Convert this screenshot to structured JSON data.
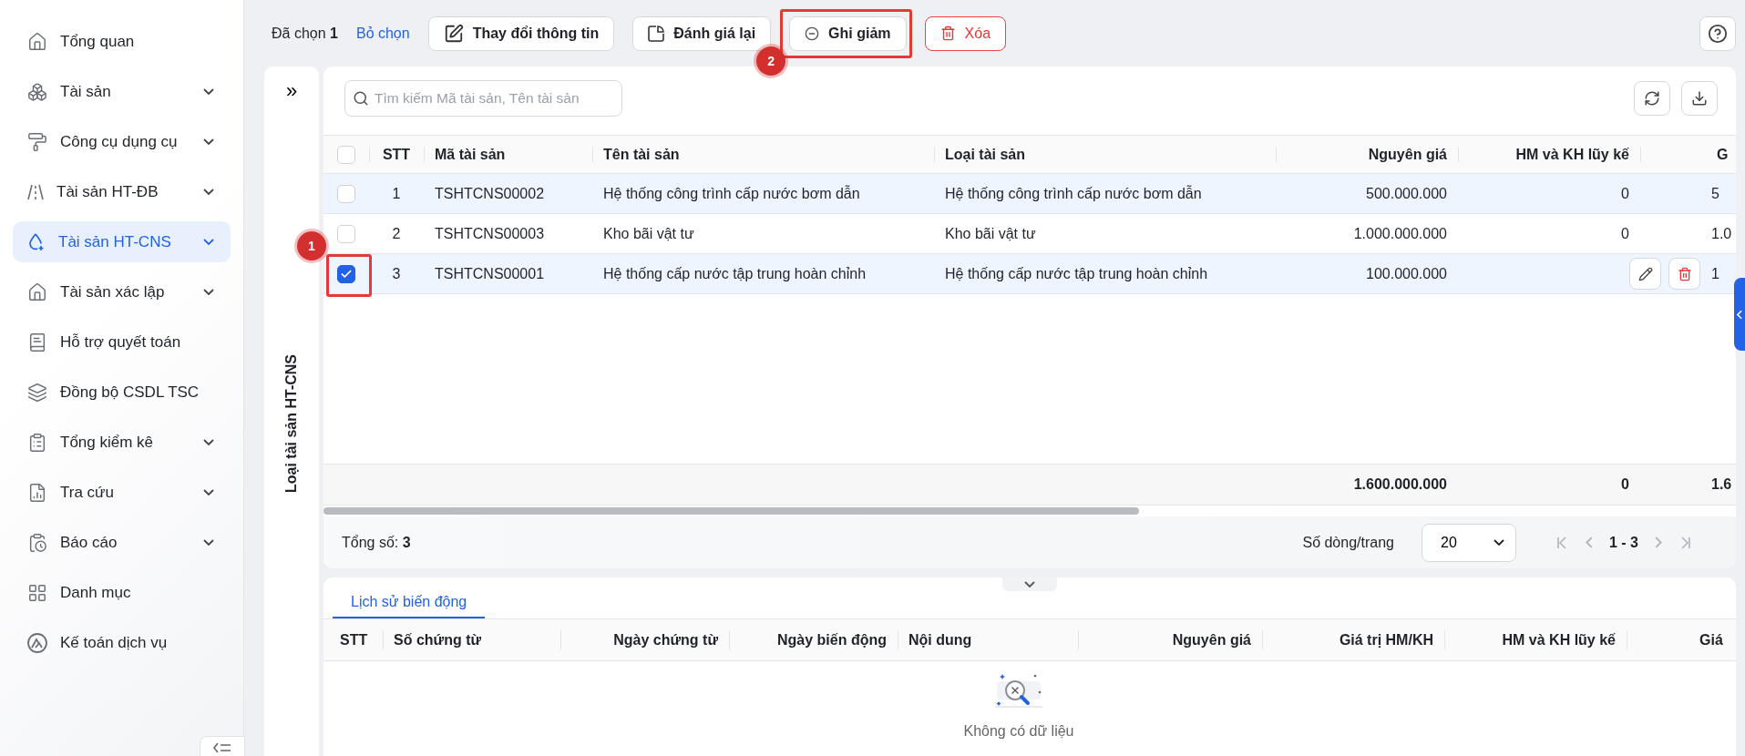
{
  "sidebar": {
    "items": [
      {
        "label": "Tổng quan",
        "expandable": false,
        "selected": false
      },
      {
        "label": "Tài sản",
        "expandable": true,
        "selected": false
      },
      {
        "label": "Công cụ dụng cụ",
        "expandable": true,
        "selected": false
      },
      {
        "label": "Tài sản HT-ĐB",
        "expandable": true,
        "selected": false
      },
      {
        "label": "Tài sản HT-CNS",
        "expandable": true,
        "selected": true
      },
      {
        "label": "Tài sản xác lập",
        "expandable": true,
        "selected": false
      },
      {
        "label": "Hỗ trợ quyết toán",
        "expandable": false,
        "selected": false
      },
      {
        "label": "Đồng bộ CSDL TSC",
        "expandable": false,
        "selected": false
      },
      {
        "label": "Tổng kiểm kê",
        "expandable": true,
        "selected": false
      },
      {
        "label": "Tra cứu",
        "expandable": true,
        "selected": false
      },
      {
        "label": "Báo cáo",
        "expandable": true,
        "selected": false
      },
      {
        "label": "Danh mục",
        "expandable": false,
        "selected": false
      },
      {
        "label": "Kế toán dịch vụ",
        "expandable": false,
        "selected": false
      }
    ]
  },
  "toolbar": {
    "selected_text": "Đã chọn **1**",
    "clear_link": "Bỏ chọn",
    "buttons": [
      {
        "label": "Thay đổi thông tin",
        "kind": "edit"
      },
      {
        "label": "Đánh giá lại",
        "kind": "revalue"
      },
      {
        "label": "Ghi giảm",
        "kind": "decrease",
        "callout": "2"
      },
      {
        "label": "Xóa",
        "kind": "delete"
      }
    ]
  },
  "side_panel": {
    "toggle": "»",
    "title": "Loại tài sản HT-CNS"
  },
  "search": {
    "placeholder": "Tìm kiếm Mã tài sản, Tên tài sản"
  },
  "table": {
    "select_all_checked": false,
    "columns": [
      "STT",
      "Mã tài sản",
      "Tên tài sản",
      "Loại tài sản",
      "Nguyên giá",
      "HM và KH lũy kế",
      "G"
    ],
    "rows": [
      {
        "cells": [
          "1",
          "TSHTCNS00002",
          "Hệ thống công trình cấp nước bơm dẫn",
          "Hệ thống công trình cấp nước bơm dẫn",
          "500.000.000",
          "0",
          "5"
        ],
        "checked": false,
        "highlighted": true,
        "show_actions": false
      },
      {
        "cells": [
          "2",
          "TSHTCNS00003",
          "Kho bãi vật tư",
          "Kho bãi vật tư",
          "1.000.000.000",
          "0",
          "1.0"
        ],
        "checked": false,
        "highlighted": false,
        "show_actions": false
      },
      {
        "cells": [
          "3",
          "TSHTCNS00001",
          "Hệ thống cấp nước tập trung hoàn chỉnh",
          "Hệ thống cấp nước tập trung hoàn chỉnh",
          "100.000.000",
          null,
          "1"
        ],
        "checked": true,
        "highlighted": true,
        "show_actions": true,
        "callout": "1"
      }
    ],
    "totals": [
      "1.600.000.000",
      "0",
      "1.6"
    ]
  },
  "pagination": {
    "total": "Tổng số: **3**",
    "rows_label": "Số dòng/trang",
    "page_size": "20",
    "range": "1 - 3",
    "prev_disabled": true,
    "next_disabled": true
  },
  "history": {
    "tabs": [
      {
        "label": "Lịch sử biến động",
        "selected": true
      }
    ],
    "columns": [
      "STT",
      "Số chứng từ",
      "Ngày chứng từ",
      "Ngày biến động",
      "Nội dung",
      "Nguyên giá",
      "Giá trị HM/KH",
      "HM và KH lũy kế",
      "Giá"
    ],
    "empty_text": "Không có dữ liệu"
  }
}
